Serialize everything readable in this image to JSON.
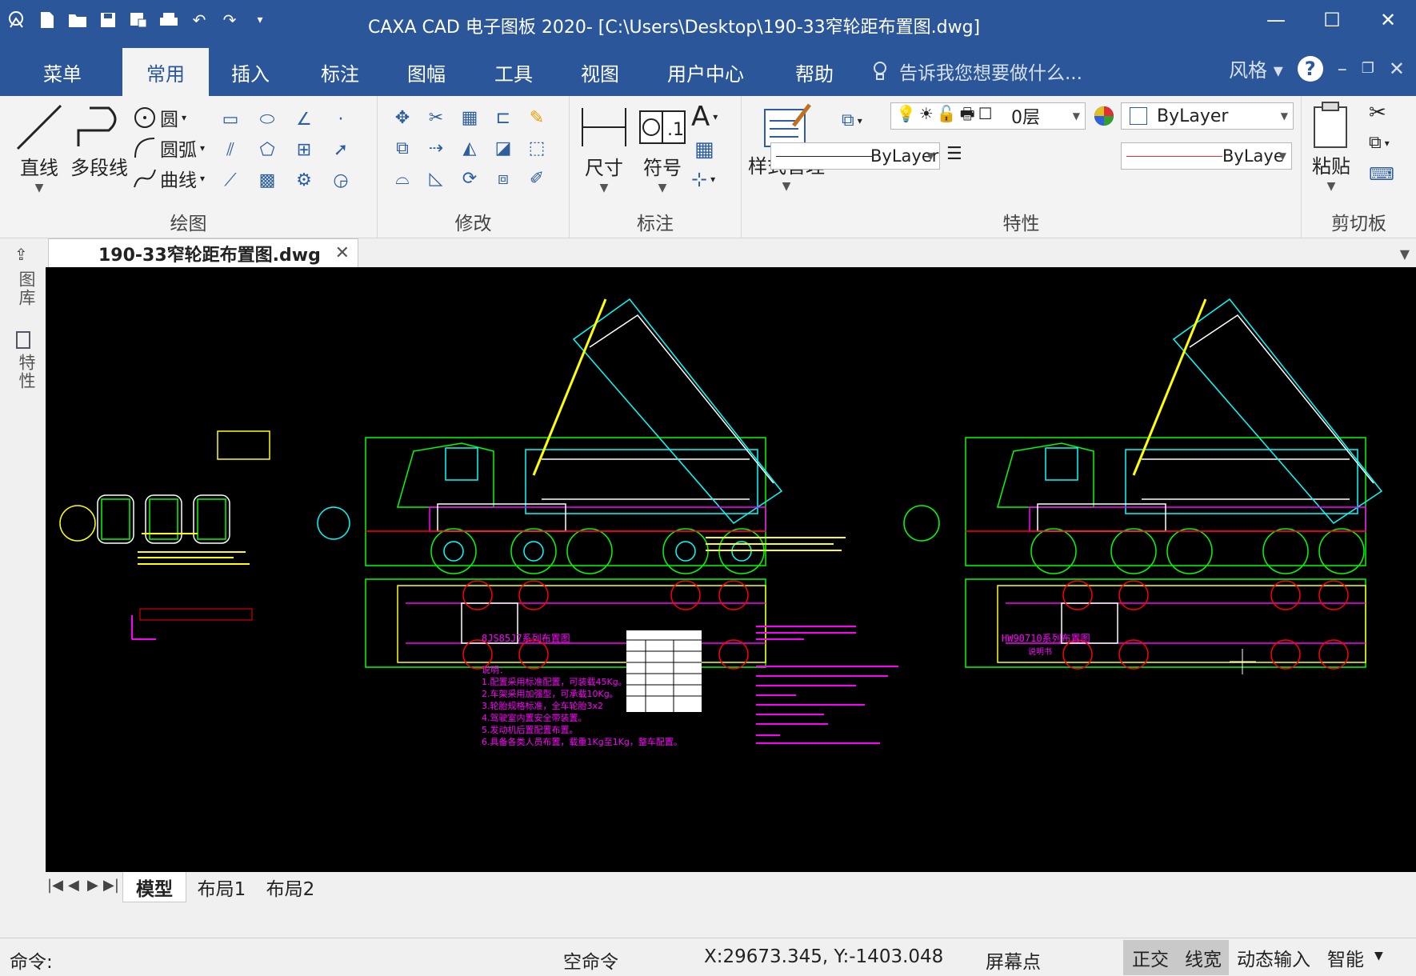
{
  "window": {
    "title": "CAXA CAD 电子图板 2020- [C:\\Users\\Desktop\\190-33窄轮距布置图.dwg]",
    "min_glyph": "—",
    "max_glyph": "☐",
    "close_glyph": "✕"
  },
  "menu": {
    "tabs": [
      "菜单",
      "常用",
      "插入",
      "标注",
      "图幅",
      "工具",
      "视图",
      "用户中心",
      "帮助"
    ],
    "active": "常用",
    "tellme_placeholder": "告诉我您想要做什么...",
    "style_label": "风格",
    "help_glyph": "?"
  },
  "ribbon": {
    "draw": {
      "label": "绘图",
      "line": "直线",
      "polyline": "多段线",
      "circle": "圆",
      "arc": "圆弧",
      "curve": "曲线"
    },
    "modify": {
      "label": "修改"
    },
    "dim": {
      "label": "标注",
      "dimension": "尺寸",
      "symbol": "符号",
      "text_glyph": "A"
    },
    "props": {
      "label": "特性",
      "style_mgr": "样式管理",
      "layer": "0层",
      "color": "ByLayer",
      "linetype": "ByLayer",
      "lineweight": "ByLaye"
    },
    "clipboard": {
      "label": "剪切板",
      "paste": "粘贴"
    }
  },
  "document": {
    "tab_title": "190-33窄轮距布置图.dwg"
  },
  "side_panel": {
    "library": "图库",
    "properties": "特性"
  },
  "drawing": {
    "title_left": "8JS85J7系列布置图",
    "title_right": "HW90710系列布置图",
    "subtitle_right": "说明书",
    "notes_heading": "说明：",
    "notes": [
      "1.配置采用标准配置，可装载45Kg。",
      "2.车架采用加强型，可承载10Kg。",
      "3.轮胎规格标准，全车轮胎3x2",
      "4.驾驶室内置安全带装置。",
      "5.发动机后置配置布置。",
      "6.具备各类人员布置，载重1Kg至1Kg，整车配置。"
    ],
    "note_color": "#ff00ff"
  },
  "layouts": {
    "tabs": [
      "模型",
      "布局1",
      "布局2"
    ],
    "active": "模型"
  },
  "status": {
    "command_label": "命令:",
    "state": "空命令",
    "coords": "X:29673.345, Y:-1403.048",
    "snap_mode": "屏幕点",
    "ortho": "正交",
    "lineweight": "线宽",
    "dyn_input": "动态输入",
    "smart": "智能"
  },
  "colors": {
    "accent": "#2b579a",
    "canvas": "#000000",
    "cad_green": "#00ff00",
    "cad_cyan": "#00ffff",
    "cad_yellow": "#ffff00",
    "cad_magenta": "#ff00ff",
    "cad_red": "#ff0000"
  }
}
